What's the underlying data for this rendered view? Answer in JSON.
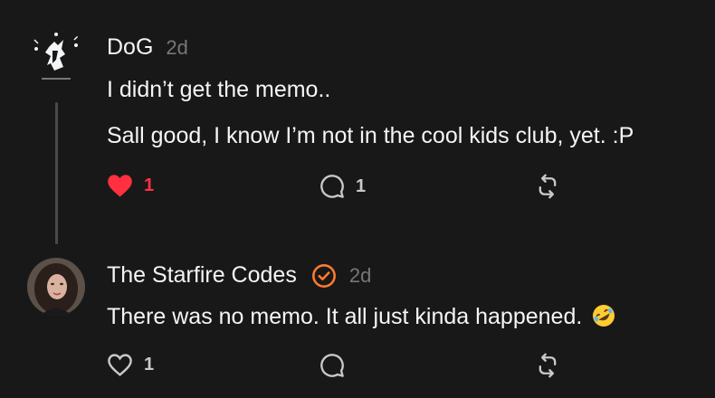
{
  "colors": {
    "background": "#181818",
    "text": "#f3f5f7",
    "muted": "#777777",
    "like_active": "#ff3040",
    "verified": "#ff7a2e"
  },
  "posts": [
    {
      "author": "DoG",
      "time": "2d",
      "lines": [
        "I didn’t get the memo..",
        "Sall good, I know I’m not in the cool kids club, yet. :P"
      ],
      "likes": "1",
      "liked": true,
      "comments": "1",
      "icons": [
        "heart-filled-icon",
        "comment-icon",
        "repost-icon"
      ]
    },
    {
      "author": "The Starfire Codes",
      "verified": true,
      "time": "2d",
      "text": "There was no memo. It all just kinda happened.",
      "emoji": "rolling-on-floor-laughing-emoji",
      "likes": "1",
      "liked": false,
      "icons": [
        "heart-outline-icon",
        "verified-badge-icon",
        "comment-icon",
        "repost-icon"
      ]
    }
  ]
}
